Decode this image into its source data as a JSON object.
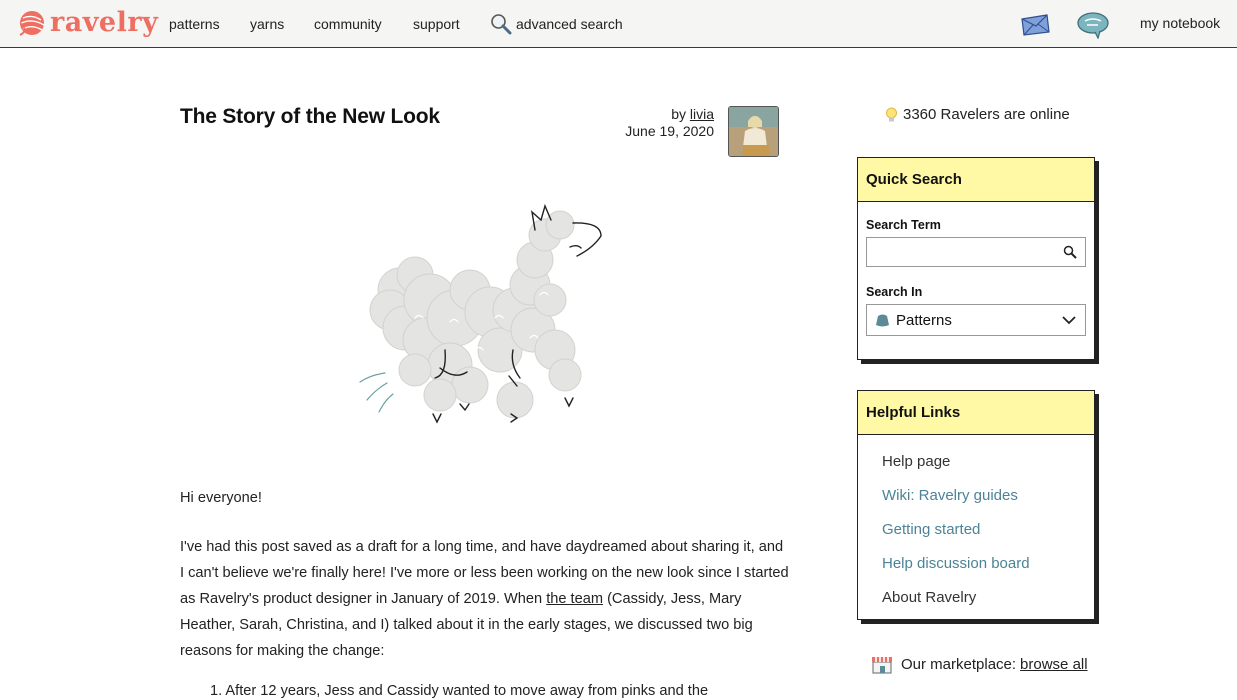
{
  "brand": {
    "name": "ravelry",
    "color": "#ee6e62"
  },
  "nav": {
    "items": [
      {
        "label": "patterns"
      },
      {
        "label": "yarns"
      },
      {
        "label": "community"
      },
      {
        "label": "support"
      }
    ],
    "advanced_search": "advanced search",
    "mail_icon": "envelope-icon",
    "chat_icon": "speech-bubble-icon",
    "notebook": "my notebook"
  },
  "post": {
    "title": "The Story of the New Look",
    "by_prefix": "by",
    "author": "livia",
    "date": "June 19, 2020",
    "greeting": "Hi everyone!",
    "para_before_link": "I've had this post saved as a draft for a long time, and have daydreamed about sharing it, and I can't believe we're finally here! I've more or less been working on the new look since I started as Ravelry's product designer in January of 2019. When ",
    "team_link": "the team",
    "para_after_link": " (Cassidy, Jess, Mary Heather, Sarah, Christina, and I) talked about it in the early stages, we discussed two big reasons for making the change:",
    "list_item_1": "1. After 12 years, Jess and Cassidy wanted to move away from pinks and the"
  },
  "sidebar": {
    "online_text": "3360 Ravelers are online",
    "quick_search": {
      "title": "Quick Search",
      "term_label": "Search Term",
      "term_value": "",
      "in_label": "Search In",
      "in_selected": "Patterns"
    },
    "helpful_links": {
      "title": "Helpful Links",
      "items": [
        {
          "label": "Help page",
          "color": "#333333"
        },
        {
          "label": "Wiki: Ravelry guides",
          "color": "#4c8396"
        },
        {
          "label": "Getting started",
          "color": "#4c8396"
        },
        {
          "label": "Help discussion board",
          "color": "#4c8396"
        },
        {
          "label": "About Ravelry",
          "color": "#333333"
        }
      ]
    },
    "marketplace": {
      "prefix": "Our marketplace:",
      "link": "browse all"
    }
  },
  "colors": {
    "highlight_yellow": "#fff9a6",
    "link_blue": "#4c8396",
    "accent": "#ee6e62"
  }
}
